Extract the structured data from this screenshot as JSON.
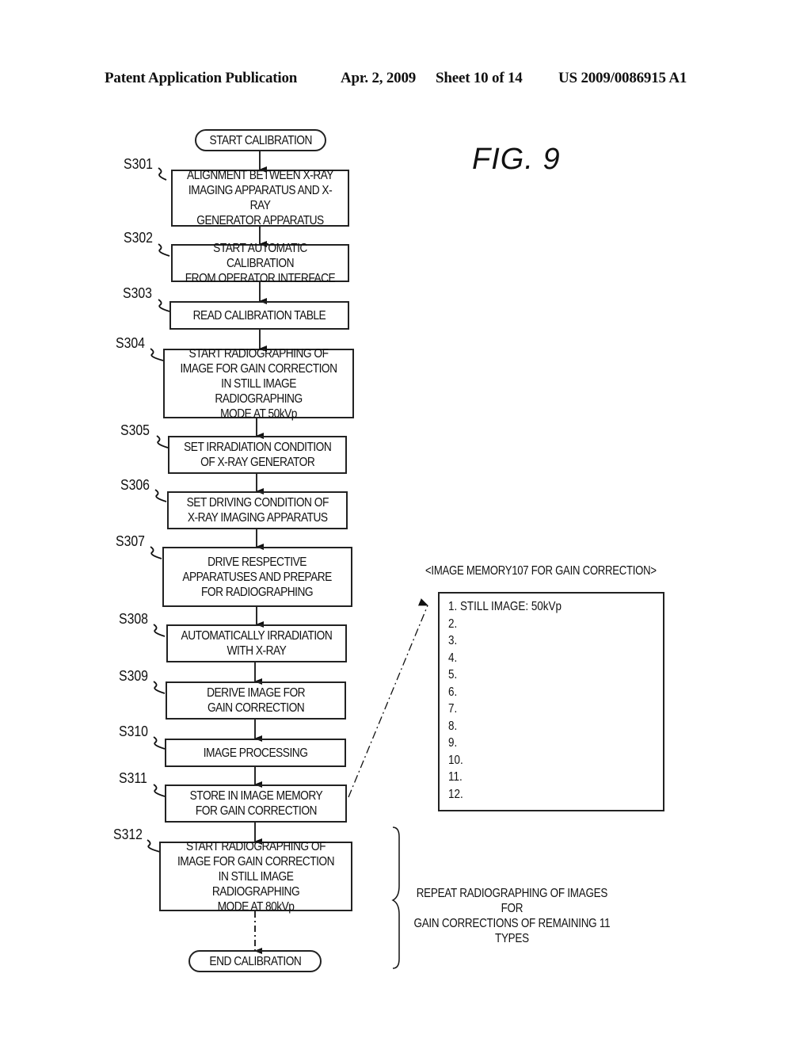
{
  "header": {
    "publication": "Patent Application Publication",
    "date": "Apr. 2, 2009",
    "sheet": "Sheet 10 of 14",
    "number": "US 2009/0086915 A1"
  },
  "figure_label": "FIG.  9",
  "flowchart": {
    "start": "START CALIBRATION",
    "end": "END CALIBRATION",
    "steps": [
      {
        "id": "S301",
        "text": "ALIGNMENT BETWEEN X-RAY\nIMAGING APPARATUS AND X-RAY\nGENERATOR APPARATUS"
      },
      {
        "id": "S302",
        "text": "START AUTOMATIC CALIBRATION\nFROM OPERATOR INTERFACE"
      },
      {
        "id": "S303",
        "text": "READ CALIBRATION TABLE"
      },
      {
        "id": "S304",
        "text": "START RADIOGRAPHING OF\nIMAGE FOR GAIN CORRECTION\nIN STILL IMAGE RADIOGRAPHING\nMODE AT 50kVp"
      },
      {
        "id": "S305",
        "text": "SET IRRADIATION CONDITION\nOF X-RAY GENERATOR"
      },
      {
        "id": "S306",
        "text": "SET DRIVING CONDITION OF\nX-RAY IMAGING APPARATUS"
      },
      {
        "id": "S307",
        "text": "DRIVE RESPECTIVE\nAPPARATUSES AND PREPARE\nFOR RADIOGRAPHING"
      },
      {
        "id": "S308",
        "text": "AUTOMATICALLY IRRADIATION\nWITH X-RAY"
      },
      {
        "id": "S309",
        "text": "DERIVE IMAGE FOR\nGAIN CORRECTION"
      },
      {
        "id": "S310",
        "text": "IMAGE PROCESSING"
      },
      {
        "id": "S311",
        "text": "STORE IN IMAGE MEMORY\nFOR GAIN CORRECTION"
      },
      {
        "id": "S312",
        "text": "START RADIOGRAPHING OF\nIMAGE FOR GAIN CORRECTION\nIN STILL IMAGE RADIOGRAPHING\nMODE AT 80kVp"
      }
    ]
  },
  "image_memory": {
    "title": "<IMAGE MEMORY107 FOR GAIN CORRECTION>",
    "items": [
      "1. STILL IMAGE: 50kVp",
      "2.",
      "3.",
      "4.",
      "5.",
      "6.",
      "7.",
      "8.",
      "9.",
      "10.",
      "11.",
      "12."
    ]
  },
  "repeat_note": "REPEAT RADIOGRAPHING OF IMAGES FOR\nGAIN CORRECTIONS OF REMAINING 11 TYPES"
}
